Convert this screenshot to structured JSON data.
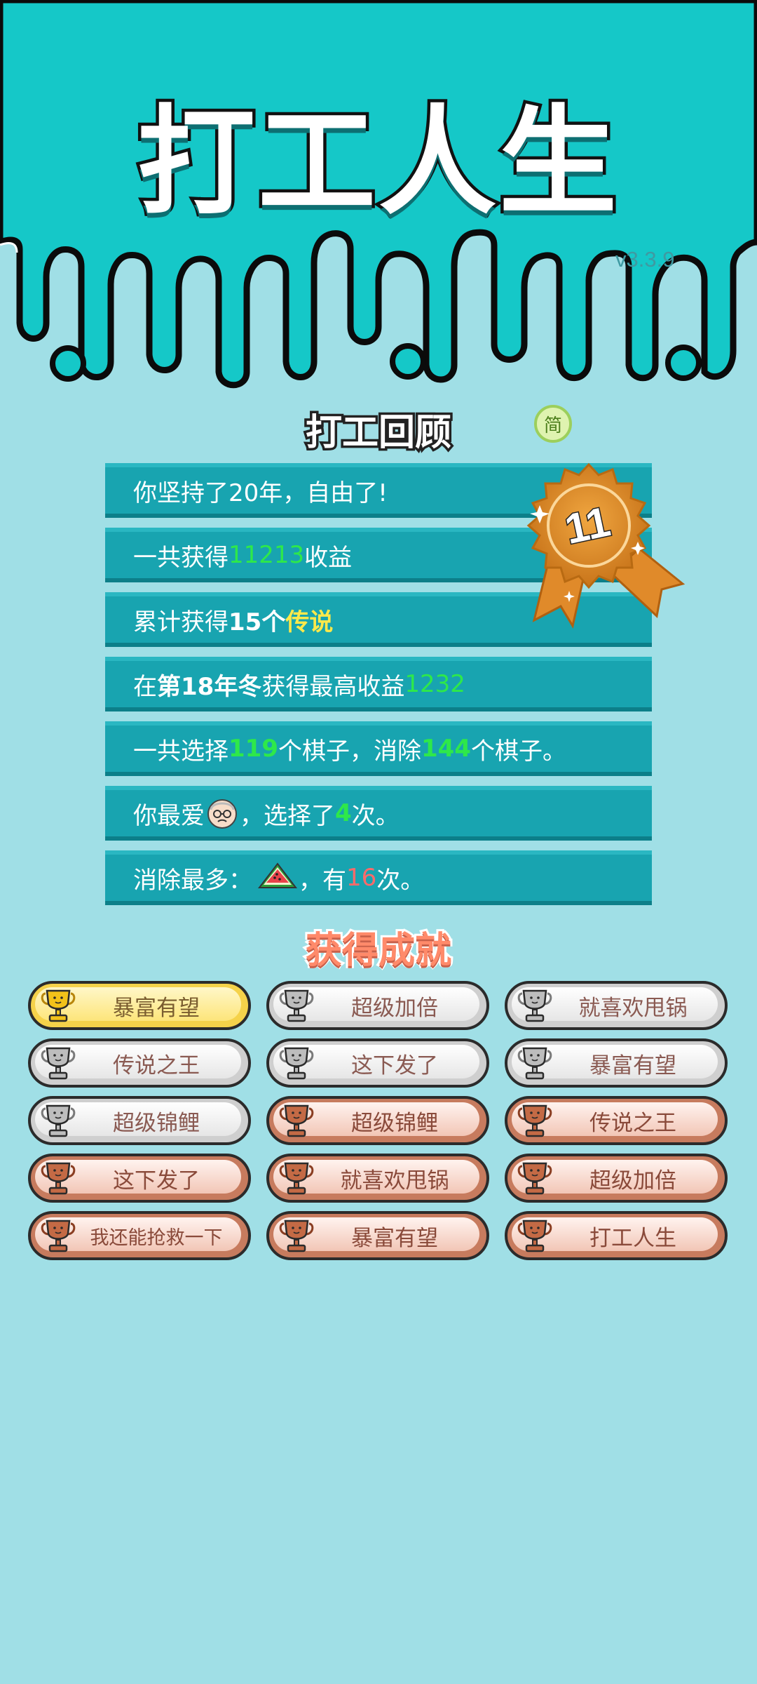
{
  "header": {
    "title": "打工人生",
    "version": "v3.3.9",
    "colors": {
      "top_bg": "#15c8c8",
      "page_bg": "#a0dfe6"
    }
  },
  "review": {
    "title": "打工回顾",
    "lang_toggle": "简",
    "medal_number": "11",
    "rows": [
      {
        "parts": [
          "你坚持了20年，自由了!"
        ]
      },
      {
        "parts": [
          "一共获得",
          "11213",
          "收益"
        ]
      },
      {
        "parts": [
          "累计获得",
          "15个",
          "传说"
        ]
      },
      {
        "parts": [
          "在 ",
          "第18年冬",
          " 获得最高收益",
          "1232"
        ]
      },
      {
        "parts": [
          "一共选择",
          "119",
          "个棋子，消除",
          "144",
          "个棋子。"
        ]
      },
      {
        "parts": [
          "你最爱",
          "face-icon",
          "，选择了",
          "4",
          "次。"
        ]
      },
      {
        "parts": [
          "消除最多：",
          "watermelon-icon",
          "，有",
          "16",
          "次。"
        ]
      }
    ]
  },
  "achievements": {
    "title": "获得成就",
    "items": [
      {
        "label": "暴富有望",
        "tier": "gold"
      },
      {
        "label": "超级加倍",
        "tier": "silver"
      },
      {
        "label": "就喜欢甩锅",
        "tier": "silver"
      },
      {
        "label": "传说之王",
        "tier": "silver"
      },
      {
        "label": "这下发了",
        "tier": "silver"
      },
      {
        "label": "暴富有望",
        "tier": "silver"
      },
      {
        "label": "超级锦鲤",
        "tier": "silver"
      },
      {
        "label": "超级锦鲤",
        "tier": "bronze"
      },
      {
        "label": "传说之王",
        "tier": "bronze"
      },
      {
        "label": "这下发了",
        "tier": "bronze"
      },
      {
        "label": "就喜欢甩锅",
        "tier": "bronze"
      },
      {
        "label": "超级加倍",
        "tier": "bronze"
      },
      {
        "label": "我还能抢救一下",
        "tier": "bronze"
      },
      {
        "label": "暴富有望",
        "tier": "bronze"
      },
      {
        "label": "打工人生",
        "tier": "bronze"
      }
    ]
  }
}
